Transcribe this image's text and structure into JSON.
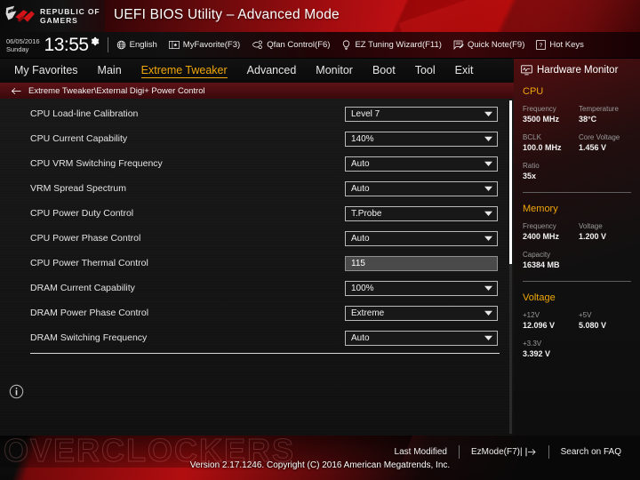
{
  "header": {
    "brand_line1": "REPUBLIC OF",
    "brand_line2": "GAMERS",
    "title": "UEFI BIOS Utility – Advanced Mode"
  },
  "toolbar": {
    "date": "06/05/2016",
    "weekday": "Sunday",
    "time": "13:55",
    "items": [
      {
        "icon": "globe-icon",
        "label": "English"
      },
      {
        "icon": "myfavorite-icon",
        "label": "MyFavorite(F3)"
      },
      {
        "icon": "qfan-icon",
        "label": "Qfan Control(F6)"
      },
      {
        "icon": "bulb-icon",
        "label": "EZ Tuning Wizard(F11)"
      },
      {
        "icon": "note-icon",
        "label": "Quick Note(F9)"
      },
      {
        "icon": "question-icon",
        "label": "Hot Keys"
      }
    ]
  },
  "tabs": [
    {
      "label": "My Favorites",
      "active": false
    },
    {
      "label": "Main",
      "active": false
    },
    {
      "label": "Extreme Tweaker",
      "active": true
    },
    {
      "label": "Advanced",
      "active": false
    },
    {
      "label": "Monitor",
      "active": false
    },
    {
      "label": "Boot",
      "active": false
    },
    {
      "label": "Tool",
      "active": false
    },
    {
      "label": "Exit",
      "active": false
    }
  ],
  "breadcrumb": {
    "back_icon": "back-arrow-icon",
    "path": "Extreme Tweaker\\External Digi+ Power Control"
  },
  "settings": [
    {
      "label": "CPU Load-line Calibration",
      "value": "Level 7",
      "type": "dropdown"
    },
    {
      "label": "CPU Current Capability",
      "value": "140%",
      "type": "dropdown"
    },
    {
      "label": "CPU VRM Switching Frequency",
      "value": "Auto",
      "type": "dropdown"
    },
    {
      "label": "VRM Spread Spectrum",
      "value": "Auto",
      "type": "dropdown"
    },
    {
      "label": "CPU Power Duty Control",
      "value": "T.Probe",
      "type": "dropdown"
    },
    {
      "label": "CPU Power Phase Control",
      "value": "Auto",
      "type": "dropdown"
    },
    {
      "label": "CPU Power Thermal Control",
      "value": "115",
      "type": "textfield"
    },
    {
      "label": "DRAM Current Capability",
      "value": "100%",
      "type": "dropdown"
    },
    {
      "label": "DRAM Power Phase Control",
      "value": "Extreme",
      "type": "dropdown"
    },
    {
      "label": "DRAM Switching Frequency",
      "value": "Auto",
      "type": "dropdown"
    }
  ],
  "info_icon": "info-icon",
  "hardware_monitor": {
    "icon": "monitor-icon",
    "title": "Hardware Monitor",
    "sections": [
      {
        "name": "CPU",
        "rows": [
          [
            {
              "key": "Frequency",
              "value": "3500 MHz"
            },
            {
              "key": "Temperature",
              "value": "38°C"
            }
          ],
          [
            {
              "key": "BCLK",
              "value": "100.0 MHz"
            },
            {
              "key": "Core Voltage",
              "value": "1.456 V"
            }
          ],
          [
            {
              "key": "Ratio",
              "value": "35x"
            }
          ]
        ]
      },
      {
        "name": "Memory",
        "rows": [
          [
            {
              "key": "Frequency",
              "value": "2400 MHz"
            },
            {
              "key": "Voltage",
              "value": "1.200 V"
            }
          ],
          [
            {
              "key": "Capacity",
              "value": "16384 MB"
            }
          ]
        ]
      },
      {
        "name": "Voltage",
        "rows": [
          [
            {
              "key": "+12V",
              "value": "12.096 V"
            },
            {
              "key": "+5V",
              "value": "5.080 V"
            }
          ],
          [
            {
              "key": "+3.3V",
              "value": "3.392 V"
            }
          ]
        ]
      }
    ]
  },
  "bottombar": {
    "last_modified": "Last Modified",
    "ezmode": "EzMode(F7)|",
    "search_faq": "Search on FAQ",
    "watermark": "OVERCLOCKERS",
    "version": "Version 2.17.1246. Copyright (C) 2016 American Megatrends, Inc."
  },
  "colors": {
    "accent_red": "#c40e10",
    "accent_amber": "#f0a70a",
    "panel_bg": "#141414",
    "text": "#e4e4e4"
  }
}
